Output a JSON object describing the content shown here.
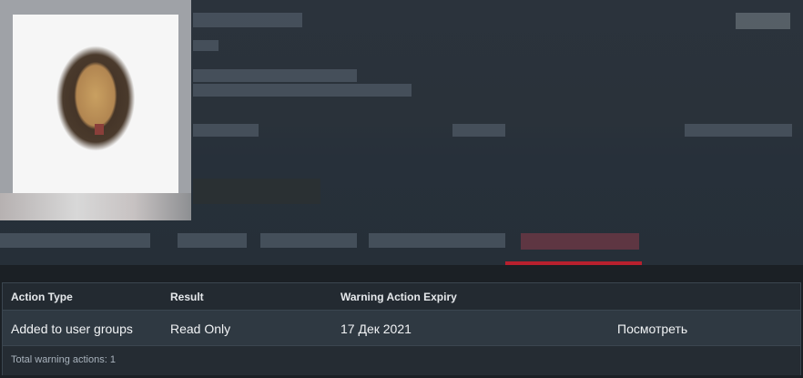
{
  "warnings_table": {
    "headers": {
      "action_type": "Action Type",
      "result": "Result",
      "expiry": "Warning Action Expiry"
    },
    "rows": [
      {
        "action_type": "Added to user groups",
        "result": "Read Only",
        "expiry": "17 Дек 2021",
        "view_link": "Посмотреть"
      }
    ],
    "footer": "Total warning actions: 1"
  },
  "colors": {
    "table_bg": "#2f3942",
    "header_bg": "#232a31",
    "accent_red": "#b8202e"
  }
}
